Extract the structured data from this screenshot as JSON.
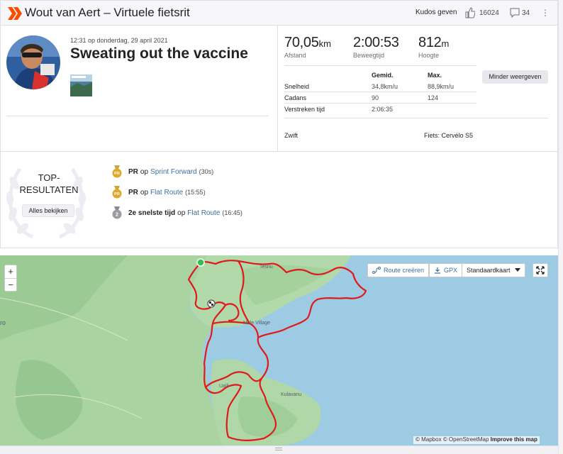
{
  "header": {
    "title": "Wout van Aert – Virtuele fietsrit",
    "kudos_label": "Kudos geven",
    "kudos_count": "16024",
    "comment_count": "34",
    "more_icon": "⋮"
  },
  "activity": {
    "date": "12:31 op donderdag, 29 april 2021",
    "title": "Sweating out the vaccine"
  },
  "stats": {
    "distance": {
      "value": "70,05",
      "unit": "km",
      "label": "Afstand"
    },
    "moving_time": {
      "value": "2:00:53",
      "label": "Beweegtijd"
    },
    "elevation": {
      "value": "812",
      "unit": "m",
      "label": "Hoogte"
    },
    "table": {
      "col_avg": "Gemid.",
      "col_max": "Max.",
      "rows": [
        {
          "label": "Snelheid",
          "avg": "34,8km/u",
          "max": "88,9km/u"
        },
        {
          "label": "Cadans",
          "avg": "90",
          "max": "124"
        },
        {
          "label": "Verstreken tijd",
          "avg": "2:06:35",
          "max": ""
        }
      ]
    },
    "less_button": "Minder weergeven",
    "source": "Zwift",
    "bike": "Fiets: Cervélo S5"
  },
  "top_results": {
    "title_line1": "TOP-",
    "title_line2": "RESULTATEN",
    "see_all": "Alles bekijken",
    "items": [
      {
        "medal": "PR",
        "strong": "PR",
        "word": "op",
        "segment": "Sprint Forward",
        "time": "(30s)"
      },
      {
        "medal": "PR",
        "strong": "PR",
        "word": "op",
        "segment": "Flat Route",
        "time": "(15:55)"
      },
      {
        "medal": "2",
        "strong": "2e snelste tijd",
        "word": "op",
        "segment": "Flat Route",
        "time": "(16:45)"
      }
    ]
  },
  "map": {
    "zoom_in": "+",
    "zoom_out": "−",
    "route_create": "Route creëren",
    "gpx": "GPX",
    "map_type": "Standaardkaart",
    "attribution_mapbox": "© Mapbox",
    "attribution_osm": "© OpenStreetMap",
    "attribution_improve": "Improve this map",
    "places": [
      "Tesnu",
      "Mule Village",
      "Ualli",
      "Kulavanu",
      "ro"
    ],
    "icons": [
      "start-marker",
      "finish-flag",
      "route-icon",
      "download-icon",
      "chevron-down-icon",
      "fullscreen-icon"
    ]
  },
  "colors": {
    "route": "#e0191b",
    "water": "#9ecbe4",
    "land": "#a7d4a0",
    "link": "#3d6f9e",
    "brand": "#fc4c02",
    "gold": "#e0a92b"
  }
}
